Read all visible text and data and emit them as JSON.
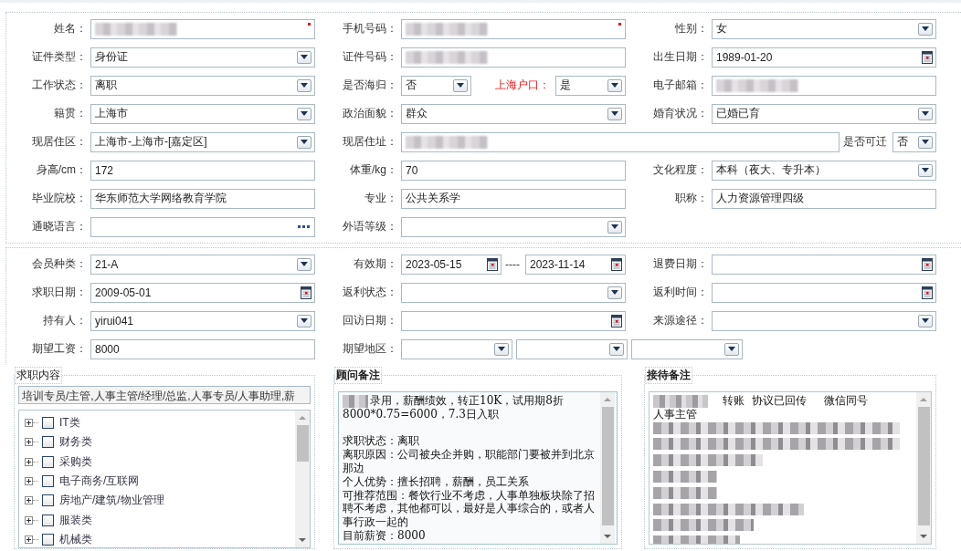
{
  "sections": [
    {
      "rows": [
        {
          "kind": "standard",
          "cells": [
            {
              "label": "姓名：",
              "controls": [
                {
                  "kind": "text",
                  "redacted": true,
                  "required": true
                }
              ]
            },
            {
              "label": "手机号码：",
              "controls": [
                {
                  "kind": "text",
                  "redacted": true,
                  "required": true
                }
              ]
            },
            {
              "label": "性别：",
              "controls": [
                {
                  "kind": "select",
                  "value": "女"
                }
              ]
            }
          ]
        },
        {
          "kind": "standard",
          "cells": [
            {
              "label": "证件类型：",
              "controls": [
                {
                  "kind": "select",
                  "value": "身份证"
                }
              ]
            },
            {
              "label": "证件号码：",
              "controls": [
                {
                  "kind": "text",
                  "redacted": true
                }
              ]
            },
            {
              "label": "出生日期：",
              "controls": [
                {
                  "kind": "date",
                  "value": "1989-01-20"
                }
              ]
            }
          ]
        },
        {
          "kind": "standard",
          "cells": [
            {
              "label": "工作状态：",
              "controls": [
                {
                  "kind": "select",
                  "value": "离职"
                }
              ]
            },
            {
              "label": "是否海归：",
              "controls": [
                {
                  "kind": "select",
                  "value": "否"
                },
                {
                  "kind": "label",
                  "text": "上海户口：",
                  "highlight": true
                },
                {
                  "kind": "select",
                  "value": "是"
                }
              ]
            },
            {
              "label": "电子邮箱：",
              "controls": [
                {
                  "kind": "text",
                  "redacted": true
                }
              ]
            }
          ]
        },
        {
          "kind": "standard",
          "cells": [
            {
              "label": "籍贯：",
              "controls": [
                {
                  "kind": "select",
                  "value": "上海市"
                }
              ]
            },
            {
              "label": "政治面貌：",
              "controls": [
                {
                  "kind": "select",
                  "value": "群众"
                }
              ]
            },
            {
              "label": "婚育状况：",
              "controls": [
                {
                  "kind": "select",
                  "value": "已婚已育"
                }
              ]
            }
          ]
        },
        {
          "kind": "wide",
          "cells": [
            {
              "label": "现居住区：",
              "controls": [
                {
                  "kind": "select",
                  "value": "上海市-上海市-[嘉定区]"
                }
              ]
            },
            {
              "label": "现居住址：",
              "controls": [
                {
                  "kind": "text",
                  "redacted": true
                },
                {
                  "kind": "label",
                  "text": "是否可迁",
                  "highlight": false
                },
                {
                  "kind": "select",
                  "value": "否"
                }
              ]
            }
          ]
        },
        {
          "kind": "standard",
          "cells": [
            {
              "label": "身高/cm：",
              "controls": [
                {
                  "kind": "text",
                  "value": "172"
                }
              ]
            },
            {
              "label": "体重/kg：",
              "controls": [
                {
                  "kind": "text",
                  "value": "70"
                }
              ]
            },
            {
              "label": "文化程度：",
              "controls": [
                {
                  "kind": "select",
                  "value": "本科（夜大、专升本）"
                }
              ]
            }
          ]
        },
        {
          "kind": "standard",
          "cells": [
            {
              "label": "毕业院校：",
              "controls": [
                {
                  "kind": "text",
                  "value": "华东师范大学网络教育学院"
                }
              ]
            },
            {
              "label": "专业：",
              "controls": [
                {
                  "kind": "text",
                  "value": "公共关系学"
                }
              ]
            },
            {
              "label": "职称：",
              "controls": [
                {
                  "kind": "text",
                  "value": "人力资源管理四级"
                }
              ]
            }
          ]
        },
        {
          "kind": "standard",
          "cells": [
            {
              "label": "通晓语言：",
              "controls": [
                {
                  "kind": "picker"
                }
              ]
            },
            {
              "label": "外语等级：",
              "controls": [
                {
                  "kind": "select"
                }
              ]
            }
          ]
        }
      ]
    },
    {
      "rows": [
        {
          "kind": "standard",
          "cells": [
            {
              "label": "会员种类：",
              "controls": [
                {
                  "kind": "select",
                  "value": "21-A"
                }
              ]
            },
            {
              "label": "有效期：",
              "controls": [
                {
                  "kind": "date",
                  "value": "2023-05-15"
                },
                {
                  "kind": "label",
                  "text": "----",
                  "highlight": false
                },
                {
                  "kind": "date",
                  "value": "2023-11-14"
                }
              ]
            },
            {
              "label": "退费日期：",
              "controls": [
                {
                  "kind": "date"
                }
              ]
            }
          ]
        },
        {
          "kind": "standard",
          "cells": [
            {
              "label": "求职日期：",
              "controls": [
                {
                  "kind": "date",
                  "value": "2009-05-01"
                }
              ]
            },
            {
              "label": "返利状态：",
              "controls": [
                {
                  "kind": "select"
                }
              ]
            },
            {
              "label": "返利时间：",
              "controls": [
                {
                  "kind": "date"
                }
              ]
            }
          ]
        },
        {
          "kind": "standard",
          "cells": [
            {
              "label": "持有人：",
              "controls": [
                {
                  "kind": "select",
                  "value": "yirui041"
                }
              ]
            },
            {
              "label": "回访日期：",
              "controls": [
                {
                  "kind": "date"
                }
              ]
            },
            {
              "label": "来源途径：",
              "controls": [
                {
                  "kind": "select"
                }
              ]
            }
          ]
        },
        {
          "kind": "wide",
          "cells": [
            {
              "label": "期望工资：",
              "controls": [
                {
                  "kind": "text",
                  "value": "8000"
                }
              ]
            },
            {
              "label": "期望地区：",
              "controls": [
                {
                  "kind": "select"
                },
                {
                  "kind": "select"
                },
                {
                  "kind": "select"
                }
              ]
            }
          ]
        }
      ]
    }
  ],
  "panels": [
    {
      "kind": "tree",
      "title": "求职内容",
      "emphasized": false,
      "summary": "培训专员/主管,人事主管/经理/总监,人事专员/人事助理,薪",
      "items": [
        {
          "label": "IT类",
          "expanded": false,
          "checked": false
        },
        {
          "label": "财务类",
          "expanded": false,
          "checked": false
        },
        {
          "label": "采购类",
          "expanded": false,
          "checked": false
        },
        {
          "label": "电子商务/互联网",
          "expanded": false,
          "checked": false
        },
        {
          "label": "房地产/建筑/物业管理",
          "expanded": false,
          "checked": false
        },
        {
          "label": "服装类",
          "expanded": false,
          "checked": false
        },
        {
          "label": "机械类",
          "expanded": false,
          "checked": false
        }
      ]
    },
    {
      "kind": "notes",
      "title": "顾问备注",
      "emphasized": true,
      "lines": [
        {
          "kind": "text",
          "redacted_prefix": true,
          "text": "录用，薪酬绩效，转正10K，试用期8折"
        },
        {
          "kind": "text",
          "redacted_prefix": false,
          "text": "8000*0.75=6000，7.3日入职"
        },
        {
          "kind": "blank"
        },
        {
          "kind": "text",
          "redacted_prefix": false,
          "text": "求职状态：离职"
        },
        {
          "kind": "text",
          "redacted_prefix": false,
          "text": "离职原因：公司被央企并购，职能部门要被并到北京那边"
        },
        {
          "kind": "text",
          "redacted_prefix": false,
          "text": "个人优势：擅长招聘，薪酬，员工关系"
        },
        {
          "kind": "text",
          "redacted_prefix": false,
          "text": "可推荐范围：餐饮行业不考虑，人事单独板块除了招聘不考虑，其他都可以，最好是人事综合的，或者人事行政一起的"
        },
        {
          "kind": "text",
          "redacted_prefix": false,
          "text": "目前薪资：8000"
        }
      ]
    },
    {
      "kind": "notes",
      "title": "接待备注",
      "emphasized": true,
      "lines": [
        {
          "kind": "text",
          "redacted_prefix": true,
          "text": "转账  协议已回传     微信同号"
        },
        {
          "kind": "text",
          "redacted_prefix": false,
          "text": "人事主管"
        },
        {
          "kind": "redacted"
        },
        {
          "kind": "redacted"
        },
        {
          "kind": "redacted"
        },
        {
          "kind": "redacted"
        },
        {
          "kind": "redacted"
        },
        {
          "kind": "redacted"
        },
        {
          "kind": "redacted"
        },
        {
          "kind": "redacted"
        }
      ]
    }
  ]
}
